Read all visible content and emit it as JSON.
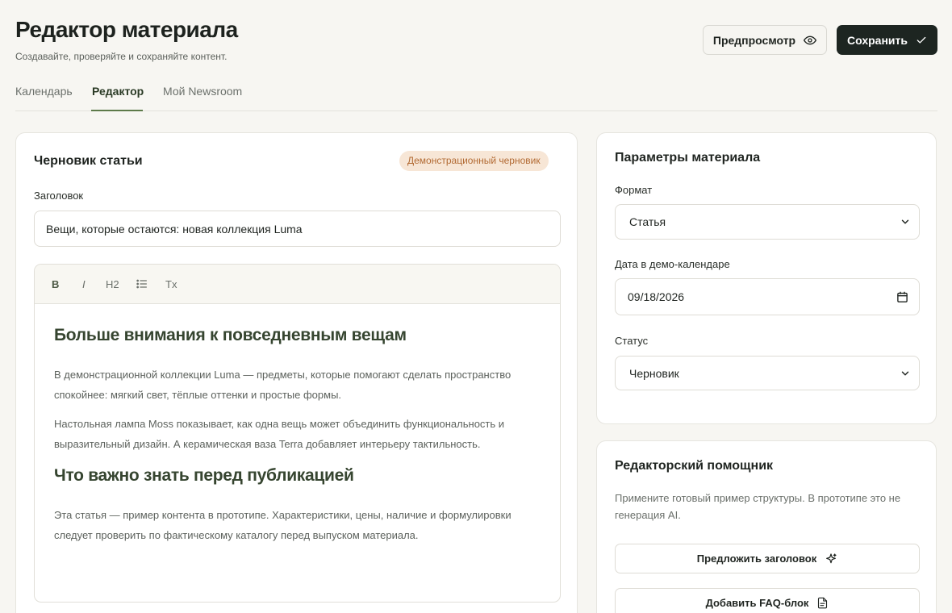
{
  "header": {
    "title": "Редактор материала",
    "subtitle": "Создавайте, проверяйте и сохраняйте контент.",
    "preview_label": "Предпросмотр",
    "save_label": "Сохранить"
  },
  "tabs": [
    {
      "label": "Календарь",
      "active": false
    },
    {
      "label": "Редактор",
      "active": true
    },
    {
      "label": "Мой Newsroom",
      "active": false
    }
  ],
  "draft": {
    "title": "Черновик статьи",
    "badge": "Демонстрационный черновик",
    "headline_label": "Заголовок",
    "headline_value": "Вещи, которые остаются: новая коллекция Luma",
    "toolbar": {
      "bold": "B",
      "italic": "I",
      "h2": "H2",
      "list_icon": "list-icon",
      "clear": "Tx"
    },
    "body": {
      "heading1": "Больше внимания к повседневным вещам",
      "para1": "В демонстрационной коллекции Luma — предметы, которые помогают сделать пространство спокойнее: мягкий свет, тёплые оттенки и простые формы.",
      "para2": "Настольная лампа Moss показывает, как одна вещь может объединить функциональность и выразительный дизайн. А керамическая ваза Terra добавляет интерьеру тактильность.",
      "heading2": "Что важно знать перед публикацией",
      "para3": "Эта статья — пример контента в прототипе. Характеристики, цены, наличие и формулировки следует проверить по фактическому каталогу перед выпуском материала."
    }
  },
  "params": {
    "title": "Параметры материала",
    "format_label": "Формат",
    "format_value": "Статья",
    "date_label": "Дата в демо-календаре",
    "date_value": "09/18/2026",
    "status_label": "Статус",
    "status_value": "Черновик"
  },
  "assistant": {
    "title": "Редакторский помощник",
    "text": "Примените готовый пример структуры. В прототипе это не генерация AI.",
    "suggest_label": "Предложить заголовок",
    "faq_label": "Добавить FAQ-блок"
  },
  "colors": {
    "primary_dark": "#1d2521",
    "accent_green": "#5d7a4a",
    "heading_green": "#364530",
    "badge_bg": "#f7e6d6",
    "badge_text": "#b26a33",
    "background": "#f7f6f2"
  }
}
